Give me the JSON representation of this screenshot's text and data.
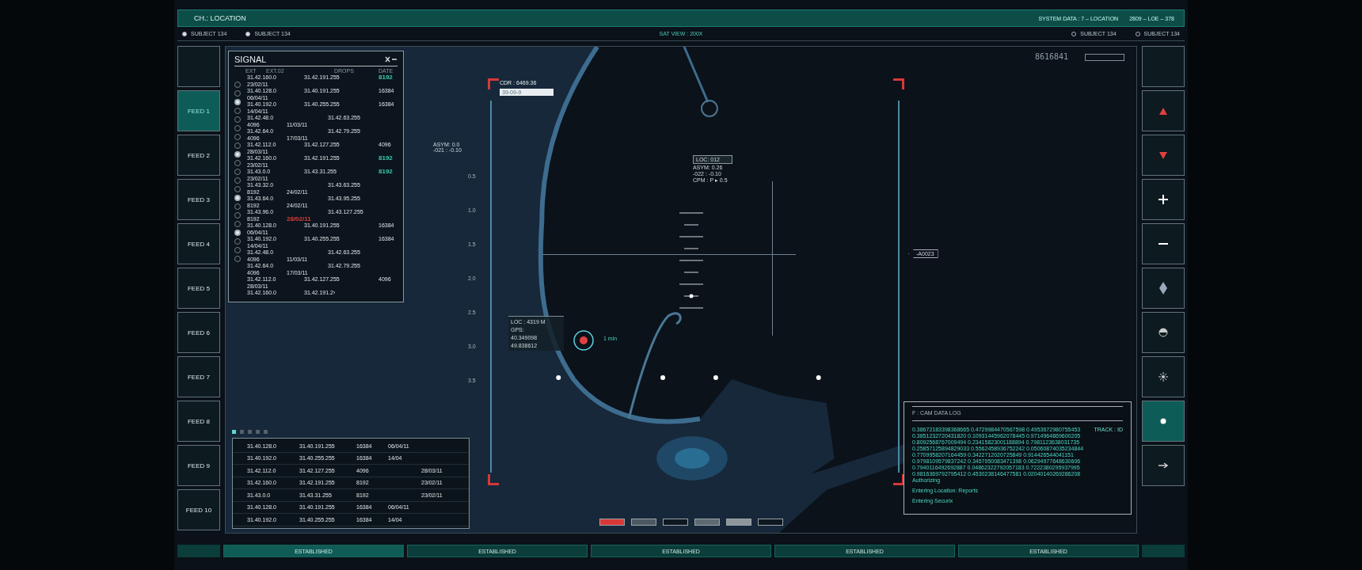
{
  "header": {
    "title": "CH.: LOCATION",
    "system_data": "SYSTEM DATA : 7 – LOCATION",
    "code": "2809 – LOE – 378"
  },
  "subjects_left": [
    {
      "label": "SUBJECT 134",
      "selected": true
    },
    {
      "label": "SUBJECT 134",
      "selected": true
    }
  ],
  "view_label": "SAT VIEW : 200X",
  "subjects_right": [
    {
      "label": "SUBJECT 134",
      "selected": false
    },
    {
      "label": "SUBJECT 134",
      "selected": false
    }
  ],
  "feeds": [
    {
      "label": "FEED 1",
      "selected": true
    },
    {
      "label": "FEED 2",
      "selected": false
    },
    {
      "label": "FEED 3",
      "selected": false
    },
    {
      "label": "FEED 4",
      "selected": false
    },
    {
      "label": "FEED 5",
      "selected": false
    },
    {
      "label": "FEED 6",
      "selected": false
    },
    {
      "label": "FEED 7",
      "selected": false
    },
    {
      "label": "FEED 8",
      "selected": false
    },
    {
      "label": "FEED 9",
      "selected": false
    },
    {
      "label": "FEED 10",
      "selected": false
    }
  ],
  "controls": [
    {
      "kind": "blank",
      "selected": false
    },
    {
      "kind": "up",
      "selected": false
    },
    {
      "kind": "down",
      "selected": false
    },
    {
      "kind": "plus",
      "selected": false
    },
    {
      "kind": "minus",
      "selected": false
    },
    {
      "kind": "diamond",
      "selected": false
    },
    {
      "kind": "half",
      "selected": false
    },
    {
      "kind": "sun",
      "selected": false
    },
    {
      "kind": "dot",
      "selected": true
    },
    {
      "kind": "arrow",
      "selected": false
    }
  ],
  "signal": {
    "title": "SIGNAL",
    "columns": [
      "EXT",
      "EXT.02",
      "DROPS",
      "DATE"
    ],
    "radios": [
      false,
      false,
      true,
      false,
      false,
      false,
      false,
      false,
      true,
      false,
      false,
      false,
      false,
      true,
      false,
      false,
      false,
      true,
      false,
      false,
      false
    ],
    "lines": [
      {
        "ext": "31.42.160.0",
        "ext_02": "31.42.191.255",
        "date": {
          "text": "8192",
          "color": "#3fc9b0"
        }
      },
      {
        "ext": "23/02/11"
      },
      {
        "ext": "31.40.128.0",
        "ext_02": "31.40.191.255",
        "date": "16384"
      },
      {
        "ext": "06/04/11"
      },
      {
        "ext": "31.40.192.0",
        "ext_02": "31.40.255.255",
        "date": "16384"
      },
      {
        "ext": "14/04/11"
      },
      {
        "ext": "31.42.48.0",
        "drops": "31.42.63.255"
      },
      {
        "ext": "4096",
        "column_2": "11/03/11"
      },
      {
        "ext": "31.42.64.0",
        "drops": "31.42.79.255"
      },
      {
        "ext": "4096",
        "column_2": "17/03/11"
      },
      {
        "ext": "31.42.112.0",
        "ext_02": "31.42.127.255",
        "date": "4096"
      },
      {
        "ext": "28/03/11"
      },
      {
        "ext": "31.42.160.0",
        "ext_02": "31.42.191.255",
        "date": {
          "text": "8192",
          "color": "#3fc9b0"
        }
      },
      {
        "ext": "23/02/11"
      },
      {
        "ext": "31.43.0.0",
        "ext_02": "31.43.31.255",
        "date": {
          "text": "8192",
          "color": "#3fc9b0"
        }
      },
      {
        "ext": "23/02/11"
      },
      {
        "ext": "31.43.32.0",
        "drops": "31.43.63.255"
      },
      {
        "ext": "8192",
        "column_2": "24/02/11"
      },
      {
        "ext": "31.43.64.0",
        "drops": "31.43.95.255"
      },
      {
        "ext": "8192",
        "column_2": "24/02/11"
      },
      {
        "ext": "31.43.96.0",
        "drops": "31.43.127.255"
      },
      {
        "ext": "8192",
        "column_2": {
          "text": "28/02/11",
          "color": "#e03a3a"
        }
      },
      {
        "ext": "31.40.128.0",
        "ext_02": "31.40.191.255",
        "date": "16384"
      },
      {
        "ext": "06/04/11"
      },
      {
        "ext": "31.40.192.0",
        "ext_02": "31.40.255.255",
        "date": "16384"
      },
      {
        "ext": "14/04/11"
      },
      {
        "ext": "31.42.48.0",
        "drops": "31.42.63.255"
      },
      {
        "ext": "4096",
        "column_2": "11/03/11"
      },
      {
        "ext": "31.42.64.0",
        "drops": "31.42.79.255"
      },
      {
        "ext": "4096",
        "column_2": "17/03/11"
      },
      {
        "ext": "31.42.112.0",
        "ext_02": "31.42.127.255",
        "date": "4096"
      },
      {
        "ext": "28/03/11"
      },
      {
        "ext": "31.42.160.0",
        "ext_02": "31.42.191.2›"
      }
    ]
  },
  "map": {
    "counter": "8616841",
    "cdr": "CDR : 6469.36",
    "cdr_field": "39-09-9",
    "asym_readout": [
      "ASYM: 0.0",
      "-021 : -0.10"
    ],
    "scale_labels": [
      "0.5",
      "1.0",
      "1.5",
      "2.0",
      "2.5",
      "3.0",
      "3.5"
    ],
    "loc_tag": "LOC: 012",
    "loc_readout": [
      "ASYM: 0.26",
      "-022 : -0.10",
      "CPM : P ▸ 0.5"
    ],
    "marker_tag": "-A0023",
    "target_time": "1 min",
    "gps": {
      "loc": "LOC : 4319 M",
      "label": "GPS:",
      "lat": "40.349098",
      "lon": "49.838612"
    },
    "swatches": [
      {
        "color": "#d83838"
      },
      {
        "color": "#4d5962"
      },
      {
        "color": "#0d1720"
      },
      {
        "color": "#5f6a73"
      },
      {
        "color": "#8e979c"
      },
      {
        "color": "#0d1720"
      }
    ]
  },
  "pager": [
    {
      "selected": true
    },
    {
      "selected": false
    },
    {
      "selected": false
    },
    {
      "selected": false
    },
    {
      "selected": false
    }
  ],
  "table": {
    "rows": [
      {
        "ext": "31.40.128.0",
        "ext_02": "31.40.191.255",
        "drops": "16384",
        "date": "06/04/11"
      },
      {
        "ext": "31.40.192.0",
        "ext_02": "31.40.255.255",
        "drops": "16384",
        "date": "14/04"
      },
      {
        "ext": "31.42.112.0",
        "ext_02": "31.42.127.255",
        "drops": "4096",
        "column_5": "28/03/11"
      },
      {
        "ext": "31.42.160.0",
        "ext_02": "31.42.191.255",
        "drops": "8192",
        "column_5": "23/02/11"
      },
      {
        "ext": "31.43.0.0",
        "ext_02": "31.43.31.255",
        "drops": "8192",
        "column_5": "23/02/11"
      },
      {
        "ext": "31.40.128.0",
        "ext_02": "31.40.191.255",
        "drops": "16384",
        "date": "06/04/11"
      },
      {
        "ext": "31.40.192.0",
        "ext_02": "31.40.255.255",
        "drops": "16384",
        "date": "14/04"
      }
    ]
  },
  "log": {
    "title": "F : CAM DATA LOG",
    "track": "TRACK : ID",
    "lines": [
      "0.38672183398368665 0.4729984470567598 0.4953672980755453",
      "0.3851232720431820 0.10931445962078445 0.9714964869600205",
      "0.8092568767009494 0.23415823001188894 0.7981123638031735",
      "0.25857125894829033 0.5562458936752242 0.05060874035234844",
      "0.7709958207164459 0.3422712020725849 0.914426544041151",
      "0.9798109579837242 0.3457950083471398 0.06294977648630606",
      "0.7940116492692887 0.04862322792057183 0.7222380295937995",
      "0.9816369792795412 0.4530238146477581 0.02040140269286208"
    ],
    "messages": [
      "Authorizing",
      "Entering Location: Reports",
      "Entering Securix"
    ]
  },
  "status": [
    {
      "label": "ESTABLISHED",
      "selected": true
    },
    {
      "label": "ESTABLISHED",
      "selected": false
    },
    {
      "label": "ESTABLISHED",
      "selected": false
    },
    {
      "label": "ESTABLISHED",
      "selected": false
    },
    {
      "label": "ESTABLISHED",
      "selected": false
    }
  ]
}
